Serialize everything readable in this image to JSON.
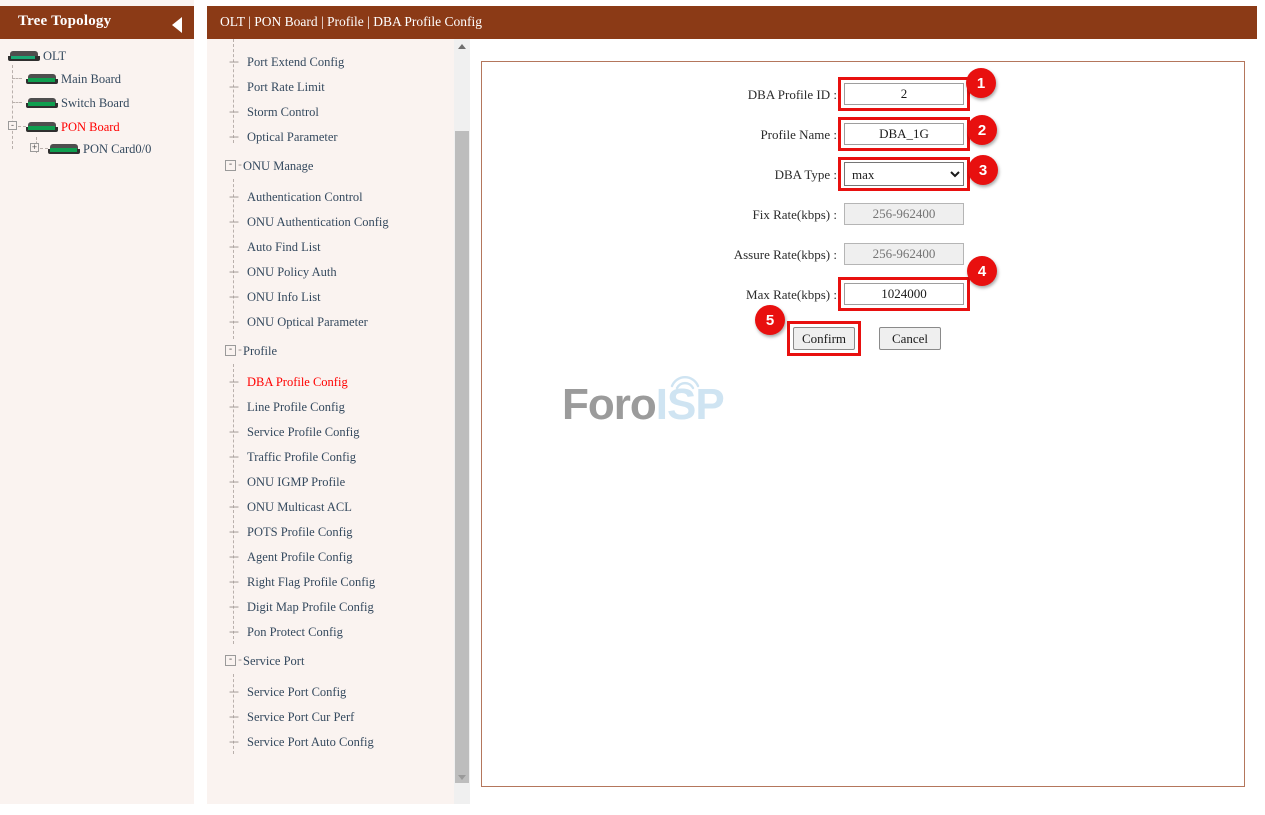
{
  "tree_panel": {
    "title": "Tree Topology",
    "collapse_icon": "caret-left-icon",
    "nodes": [
      {
        "label": "OLT",
        "icon": "device-icon",
        "indent": 0,
        "selected": false,
        "expander": ""
      },
      {
        "label": "Main Board",
        "icon": "device-icon",
        "indent": 1,
        "selected": false,
        "expander": ""
      },
      {
        "label": "Switch Board",
        "icon": "device-icon",
        "indent": 1,
        "selected": false,
        "expander": ""
      },
      {
        "label": "PON Board",
        "icon": "device-icon",
        "indent": 1,
        "selected": true,
        "expander": "-"
      },
      {
        "label": "PON Card0/0",
        "icon": "device-icon",
        "indent": 2,
        "selected": false,
        "expander": "+"
      }
    ]
  },
  "breadcrumb": {
    "text": "OLT | PON Board | Profile | DBA Profile Config"
  },
  "menu": {
    "items": [
      {
        "label": "Port Extend Config",
        "type": "leaf",
        "selected": false
      },
      {
        "label": "Port Rate Limit",
        "type": "leaf",
        "selected": false
      },
      {
        "label": "Storm Control",
        "type": "leaf",
        "selected": false
      },
      {
        "label": "Optical Parameter",
        "type": "leaf",
        "selected": false
      },
      {
        "label": "ONU Manage",
        "type": "group",
        "selected": false
      },
      {
        "label": "Authentication Control",
        "type": "leaf",
        "selected": false
      },
      {
        "label": "ONU Authentication Config",
        "type": "leaf",
        "selected": false
      },
      {
        "label": "Auto Find List",
        "type": "leaf",
        "selected": false
      },
      {
        "label": "ONU Policy Auth",
        "type": "leaf",
        "selected": false
      },
      {
        "label": "ONU Info List",
        "type": "leaf",
        "selected": false
      },
      {
        "label": "ONU Optical Parameter",
        "type": "leaf",
        "selected": false
      },
      {
        "label": "Profile",
        "type": "group",
        "selected": false
      },
      {
        "label": "DBA Profile Config",
        "type": "leaf",
        "selected": true
      },
      {
        "label": "Line Profile Config",
        "type": "leaf",
        "selected": false
      },
      {
        "label": "Service Profile Config",
        "type": "leaf",
        "selected": false
      },
      {
        "label": "Traffic Profile Config",
        "type": "leaf",
        "selected": false
      },
      {
        "label": "ONU IGMP Profile",
        "type": "leaf",
        "selected": false
      },
      {
        "label": "ONU Multicast ACL",
        "type": "leaf",
        "selected": false
      },
      {
        "label": "POTS Profile Config",
        "type": "leaf",
        "selected": false
      },
      {
        "label": "Agent Profile Config",
        "type": "leaf",
        "selected": false
      },
      {
        "label": "Right Flag Profile Config",
        "type": "leaf",
        "selected": false
      },
      {
        "label": "Digit Map Profile Config",
        "type": "leaf",
        "selected": false
      },
      {
        "label": "Pon Protect Config",
        "type": "leaf",
        "selected": false
      },
      {
        "label": "Service Port",
        "type": "group",
        "selected": false
      },
      {
        "label": "Service Port Config",
        "type": "leaf",
        "selected": false
      },
      {
        "label": "Service Port Cur Perf",
        "type": "leaf",
        "selected": false
      },
      {
        "label": "Service Port Auto Config",
        "type": "leaf",
        "selected": false
      }
    ],
    "scrollbar": {
      "up_icon": "scroll-up-arrow-icon",
      "down_icon": "scroll-down-arrow-icon"
    }
  },
  "form": {
    "fields": [
      {
        "label": "DBA Profile ID :",
        "value": "2",
        "placeholder": "",
        "kind": "text",
        "disabled": false,
        "highlighted": true
      },
      {
        "label": "Profile Name :",
        "value": "DBA_1G",
        "placeholder": "",
        "kind": "text",
        "disabled": false,
        "highlighted": true
      },
      {
        "label": "DBA Type :",
        "value": "max",
        "placeholder": "",
        "kind": "select",
        "disabled": false,
        "highlighted": true
      },
      {
        "label": "Fix Rate(kbps) :",
        "value": "",
        "placeholder": "256-962400",
        "kind": "text",
        "disabled": true,
        "highlighted": false
      },
      {
        "label": "Assure Rate(kbps) :",
        "value": "",
        "placeholder": "256-962400",
        "kind": "text",
        "disabled": true,
        "highlighted": false
      },
      {
        "label": "Max Rate(kbps) :",
        "value": "1024000",
        "placeholder": "",
        "kind": "text",
        "disabled": false,
        "highlighted": true
      }
    ],
    "dba_type_options": [
      "max"
    ],
    "confirm_label": "Confirm",
    "cancel_label": "Cancel"
  },
  "badges": [
    {
      "number": "1"
    },
    {
      "number": "2"
    },
    {
      "number": "3"
    },
    {
      "number": "4"
    },
    {
      "number": "5"
    }
  ],
  "watermark": {
    "text_primary": "Foro",
    "text_secondary": "ISP",
    "wifi_icon": "wifi-arcs-icon"
  },
  "colors": {
    "header": "#8b3a16",
    "panel_bg": "#faf3f0",
    "highlight": "#e8100f",
    "selected_text": "#ff0000",
    "panel_border": "#b4765c"
  }
}
